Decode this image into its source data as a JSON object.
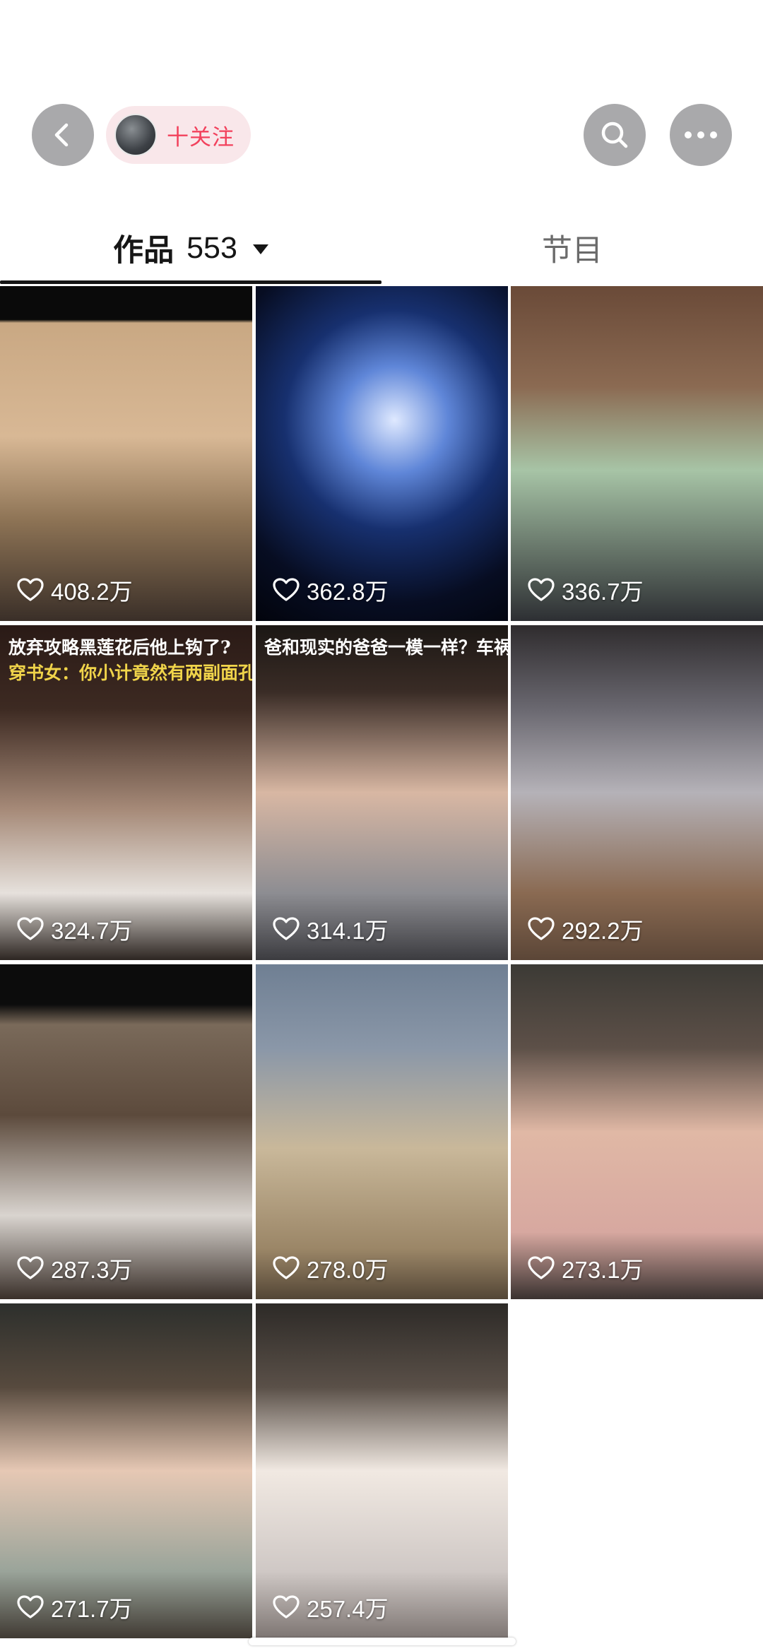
{
  "header": {
    "follow_label": "十关注",
    "colors": {
      "follow_bg": "#f9e7ea",
      "follow_text": "#f2415c",
      "button_bg": "#a9a9ab"
    },
    "icons": [
      "back-icon",
      "search-icon",
      "more-icon"
    ]
  },
  "tabs": {
    "works_label": "作品",
    "works_count": "553",
    "program_label": "节目"
  },
  "videos": [
    {
      "likes": "408.2万",
      "caption": []
    },
    {
      "likes": "362.8万",
      "caption": []
    },
    {
      "likes": "336.7万",
      "caption": []
    },
    {
      "likes": "324.7万",
      "caption": [
        "放弃攻略黑莲花后他上钩了?",
        "穿书女：你小计竟然有两副面孔"
      ]
    },
    {
      "likes": "314.1万",
      "caption": [
        "爸和现实的爸爸一模一样？车祸去世的他终于又"
      ]
    },
    {
      "likes": "292.2万",
      "caption": []
    },
    {
      "likes": "287.3万",
      "caption": []
    },
    {
      "likes": "278.0万",
      "caption": []
    },
    {
      "likes": "273.1万",
      "caption": []
    },
    {
      "likes": "271.7万",
      "caption": []
    },
    {
      "likes": "257.4万",
      "caption": []
    }
  ]
}
